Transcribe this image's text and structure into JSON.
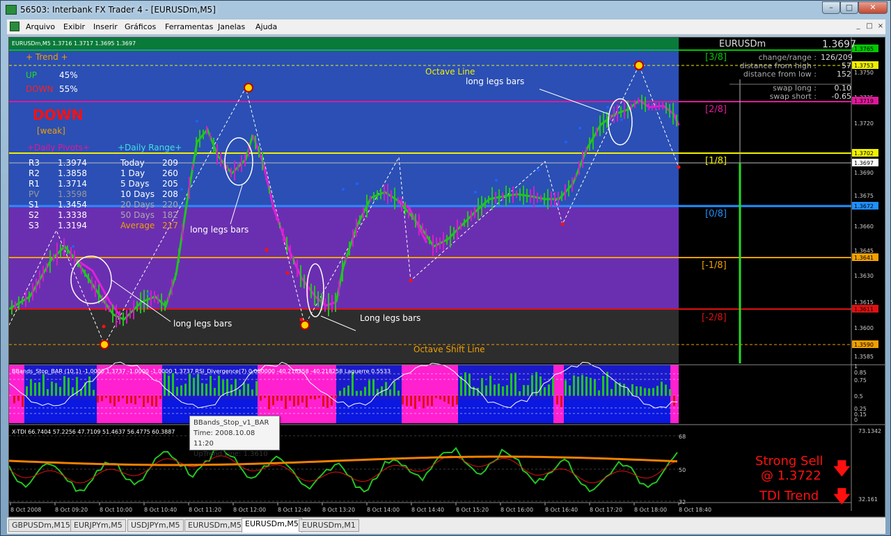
{
  "window": {
    "title": "56503: Interbank FX Trader 4 - [EURUSDm,M5]",
    "buttons": {
      "minimize": "–",
      "maximize": "□",
      "close": "✕"
    }
  },
  "menu": [
    "Arquivo",
    "Exibir",
    "Inserir",
    "Gráficos",
    "Ferramentas",
    "Janelas",
    "Ajuda"
  ],
  "mdi_buttons": [
    "_",
    "□",
    "×"
  ],
  "chart_header": "EURUSDm,M5  1.3716 1.3717 1.3695 1.3697",
  "trend": {
    "title": "+ Trend +",
    "up_label": "UP",
    "up_value": "45%",
    "down_label": "DOWN",
    "down_value": "55%",
    "signal": "DOWN",
    "strength": "[weak]"
  },
  "pivots": {
    "title": "+Daily Pivots+",
    "rows": [
      {
        "label": "R3",
        "value": "1.3974"
      },
      {
        "label": "R2",
        "value": "1.3858"
      },
      {
        "label": "R1",
        "value": "1.3714"
      },
      {
        "label": "PV",
        "value": "1.3598"
      },
      {
        "label": "S1",
        "value": "1.3454"
      },
      {
        "label": "S2",
        "value": "1.3338"
      },
      {
        "label": "S3",
        "value": "1.3194"
      }
    ]
  },
  "daily_range": {
    "title": "+Daily Range+",
    "rows": [
      {
        "label": "Today",
        "value": "209"
      },
      {
        "label": "1 Day",
        "value": "260"
      },
      {
        "label": "5 Days",
        "value": "205"
      },
      {
        "label": "10 Days",
        "value": "208"
      },
      {
        "label": "20 Days",
        "value": "220"
      },
      {
        "label": "50 Days",
        "value": "182"
      },
      {
        "label": "Average",
        "value": "217"
      }
    ]
  },
  "info": {
    "symbol": "EURUSDm",
    "price": "1.3697",
    "rows": [
      {
        "label": "change/range :",
        "value": "126/209"
      },
      {
        "label": "distance from high :",
        "value": "57"
      },
      {
        "label": "distance from low :",
        "value": "152"
      },
      {
        "label": "swap long :",
        "value": "0.10"
      },
      {
        "label": "swap short :",
        "value": "-0.65"
      }
    ]
  },
  "octave_labels": [
    "[3/8]",
    "[2/8]",
    "[1/8]",
    "[0/8]",
    "[-1/8]",
    "[-2/8]"
  ],
  "annotations": {
    "octave_line": "Octave Line",
    "octave_shift": "Octave Shift Line",
    "long_legs_1": "long legs bars",
    "long_legs_2": "long legs bars",
    "long_legs_3": "Long legs bars",
    "long_legs_4": "long legs bars"
  },
  "price_axis": [
    "1.3765",
    "1.3753",
    "1.3750",
    "1.3735",
    "1.3719",
    "1.3720",
    "1.3702",
    "1.3697",
    "1.3690",
    "1.3675",
    "1.3672",
    "1.3660",
    "1.3645",
    "1.3641",
    "1.3630",
    "1.3615",
    "1.3611",
    "1.3600",
    "1.3590",
    "1.3585"
  ],
  "indicator1_header": "BBands_Stop_BAR (10,1) -1.0000 1.3737 -1.0000 -1.0000 1.3737  RSI_Divergence(7) 0.000000 -40.218258 -40.218258  Laguerre 0.5533",
  "indicator1_axis": [
    "1",
    "0.85",
    "0.75",
    "0.5",
    "0.25",
    "0.15",
    "0"
  ],
  "indicator2_header": "X-TDI 66.7404 57.2256 47.7109 51.4637 56.4775 60.3887",
  "indicator2_axis": [
    "73.1342",
    "68",
    "50",
    "32",
    "32.161"
  ],
  "tooltip": {
    "line1": "BBands_Stop_v1_BAR",
    "line2": "Time: 2008.10.08 11:20",
    "line3": "UpTrend Line: 1.3610"
  },
  "signals": {
    "strong_sell": "Strong Sell",
    "strong_sell_price": "@ 1.3722",
    "tdi_trend": "TDI Trend"
  },
  "time_axis": [
    "8 Oct 2008",
    "8 Oct 09:20",
    "8 Oct 10:00",
    "8 Oct 10:40",
    "8 Oct 11:20",
    "8 Oct 12:00",
    "8 Oct 12:40",
    "8 Oct 13:20",
    "8 Oct 14:00",
    "8 Oct 14:40",
    "8 Oct 15:20",
    "8 Oct 16:00",
    "8 Oct 16:40",
    "8 Oct 17:20",
    "8 Oct 18:00",
    "8 Oct 18:40"
  ],
  "tabs": [
    {
      "label": "GBPUSDm,M15",
      "active": false
    },
    {
      "label": "EURJPYm,M5",
      "active": false
    },
    {
      "label": "USDJPYm,M5",
      "active": false
    },
    {
      "label": "EURUSDm,M5",
      "active": false
    },
    {
      "label": "EURUSDm,M5",
      "active": true
    },
    {
      "label": "EURUSDm,M1",
      "active": false
    }
  ],
  "colors": {
    "zone_top": "#2b4fb4",
    "zone_mid": "#6a2fb0",
    "zone_bottom": "#2d2d2d",
    "octave_3_8": "#00c800",
    "octave_2_8": "#e0189a",
    "octave_1_8": "#f0f000",
    "octave_0_8": "#1e90ff",
    "octave_m1_8": "#f0a000",
    "octave_m2_8": "#e01010",
    "bull_line": "#22c422",
    "bear_line": "#e020d8",
    "signal_red": "#ff1010"
  }
}
